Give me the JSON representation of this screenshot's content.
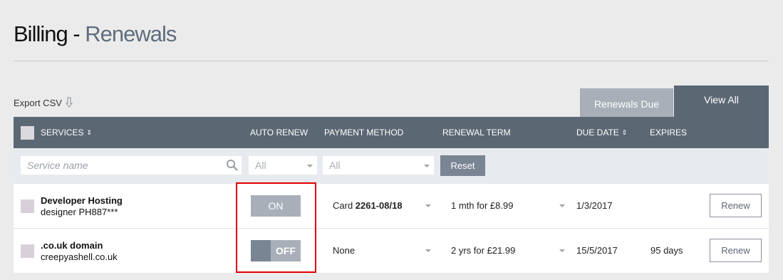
{
  "page": {
    "title_prefix": "Billing - ",
    "title_section": "Renewals"
  },
  "toolbar": {
    "export_label": "Export CSV",
    "tabs": [
      {
        "label": "Renewals Due",
        "active": false
      },
      {
        "label": "View All",
        "active": true
      }
    ]
  },
  "table": {
    "columns": {
      "services": "SERVICES",
      "auto_renew": "AUTO RENEW",
      "payment_method": "PAYMENT METHOD",
      "renewal_term": "RENEWAL TERM",
      "due_date": "DUE DATE",
      "expires": "EXPIRES"
    },
    "sort_glyph": "⇕",
    "filters": {
      "search_placeholder": "Service name",
      "auto_renew_value": "All",
      "payment_value": "All",
      "reset_label": "Reset"
    },
    "rows": [
      {
        "name": "Developer Hosting",
        "sub": "designer PH887***",
        "auto_renew": "ON",
        "payment_prefix": "Card ",
        "payment_bold": "2261-08/18",
        "term": "1 mth for £8.99",
        "due": "1/3/2017",
        "expires": "",
        "action": "Renew"
      },
      {
        "name": ".co.uk domain",
        "sub": "creepyashell.co.uk",
        "auto_renew": "OFF",
        "payment_prefix": "None",
        "payment_bold": "",
        "term": "2 yrs for £21.99",
        "due": "15/5/2017",
        "expires": "95 days",
        "action": "Renew"
      }
    ]
  },
  "colors": {
    "header_bg": "#5c6774",
    "accent_title": "#5f6d7c",
    "highlight": "#e00000"
  },
  "icons": {
    "export": "download-icon",
    "search": "search-icon",
    "sort": "sort-icon",
    "dropdown": "chevron-down-icon"
  }
}
